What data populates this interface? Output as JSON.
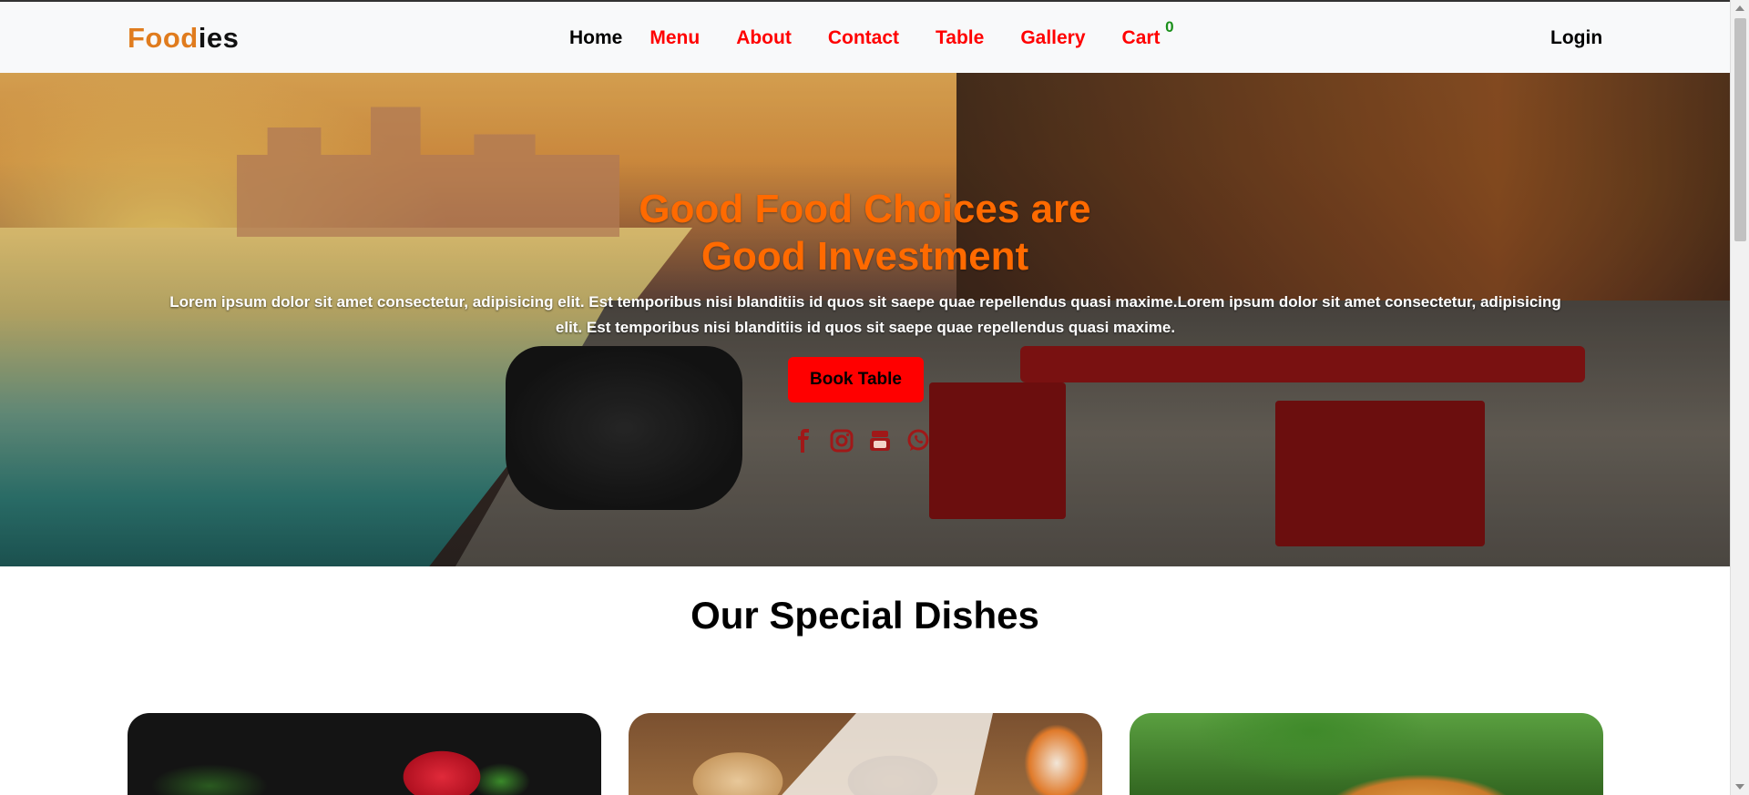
{
  "navbar": {
    "brand_part1": "Food",
    "brand_part2": "ies",
    "links": [
      {
        "label": "Home",
        "active": true
      },
      {
        "label": "Menu"
      },
      {
        "label": "About"
      },
      {
        "label": "Contact"
      },
      {
        "label": "Table"
      },
      {
        "label": "Gallery"
      },
      {
        "label": "Cart"
      }
    ],
    "cart_count": "0",
    "login_label": "Login"
  },
  "hero": {
    "title_line1": "Good Food Choices are",
    "title_line2": "Good Investment",
    "text": "Lorem ipsum dolor sit amet consectetur, adipisicing elit. Est temporibus nisi blanditiis id quos sit saepe quae repellendus quasi maxime.Lorem ipsum dolor sit amet consectetur, adipisicing elit. Est temporibus nisi blanditiis id quos sit saepe quae repellendus quasi maxime.",
    "button_label": "Book Table",
    "social_icons": [
      "facebook-icon",
      "instagram-icon",
      "youtube-icon",
      "whatsapp-icon"
    ]
  },
  "section": {
    "title": "Our Special Dishes"
  },
  "colors": {
    "brand_orange": "#e07c1e",
    "nav_red": "#ff0000",
    "hero_title": "#ff6a00",
    "cart_count": "#1a8f1a"
  }
}
